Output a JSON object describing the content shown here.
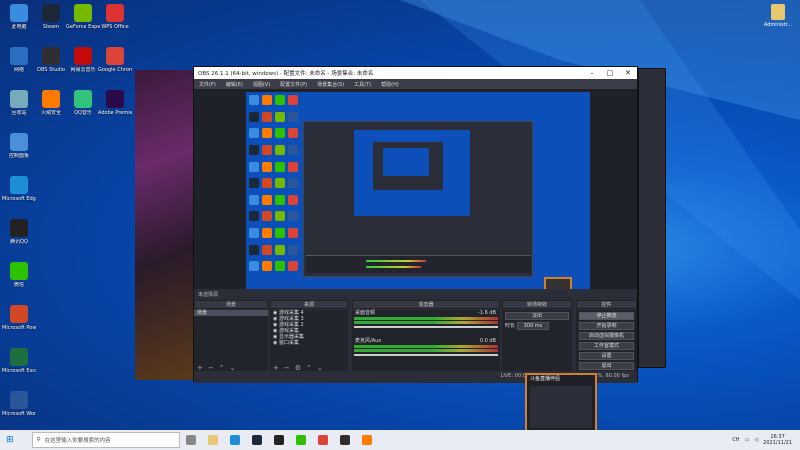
{
  "desktop": {
    "icons": [
      {
        "label": "此电脑",
        "color": "#3a8dde"
      },
      {
        "label": "网络",
        "color": "#2a6fc0"
      },
      {
        "label": "回收站",
        "color": "#7ab"
      },
      {
        "label": "控制面板",
        "color": "#4a90d9"
      },
      {
        "label": "Microsoft Edge",
        "color": "#1c8fd8"
      },
      {
        "label": "腾讯QQ",
        "color": "#222"
      },
      {
        "label": "微信",
        "color": "#2dc100"
      },
      {
        "label": "Microsoft PowerPoint",
        "color": "#d24726"
      },
      {
        "label": "Microsoft Excel 2016",
        "color": "#1d6f42"
      },
      {
        "label": "Microsoft Word 2016",
        "color": "#2b579a"
      },
      {
        "label": "Steam",
        "color": "#1b2838"
      },
      {
        "label": "OBS Studio",
        "color": "#302e31"
      },
      {
        "label": "火绒安全",
        "color": "#ff7a00"
      },
      {
        "label": "GeForce Experience",
        "color": "#76b900"
      },
      {
        "label": "网易云音乐",
        "color": "#c20c0c"
      },
      {
        "label": "QQ音乐",
        "color": "#31c27c"
      },
      {
        "label": "WPS Office",
        "color": "#d33"
      },
      {
        "label": "Google Chrome",
        "color": "#db4437"
      },
      {
        "label": "Adobe Premiere Pro",
        "color": "#2a0a4a"
      }
    ]
  },
  "obs": {
    "title": "OBS 26.1.1 (64-bit, windows) - 配置文件: 未命名 - 场景集合: 未命名",
    "menu": [
      "文件(F)",
      "编辑(E)",
      "视图(V)",
      "配置文件(P)",
      "场景集合(S)",
      "工具(T)",
      "帮助(H)"
    ],
    "docks": {
      "scenes": "场景",
      "sources": "来源",
      "mixer": "混音器",
      "transitions": "转场特效",
      "controls": "控件"
    },
    "no_source": "未选择源",
    "scene_items": [
      "场景"
    ],
    "source_items": [
      "游戏采集 4",
      "游戏采集 3",
      "游戏采集 2",
      "游戏采集",
      "显示器采集",
      "窗口采集"
    ],
    "mixer_items": [
      {
        "name": "桌面音频",
        "db": "-1.6 dB"
      },
      {
        "name": "麦克风/Aux",
        "db": "0.0 dB"
      }
    ],
    "transition": {
      "type": "淡出",
      "duration_label": "时长",
      "duration": "300 ms"
    },
    "controls": [
      "停止推流",
      "开始录制",
      "启动虚拟摄像机",
      "工作室模式",
      "设置",
      "退出"
    ],
    "status": "LIVE: 00:00:00   REC: 00:00:00   CPU: 6.2%, 60.00 fps"
  },
  "thumbnail": {
    "title": "斗鱼直播伴侣"
  },
  "taskbar": {
    "search_placeholder": "在这里输入你要搜索的内容",
    "tray_text": "CH",
    "time": "16:37",
    "date": "2021/11/21"
  },
  "admin": {
    "label": "Administr..."
  }
}
